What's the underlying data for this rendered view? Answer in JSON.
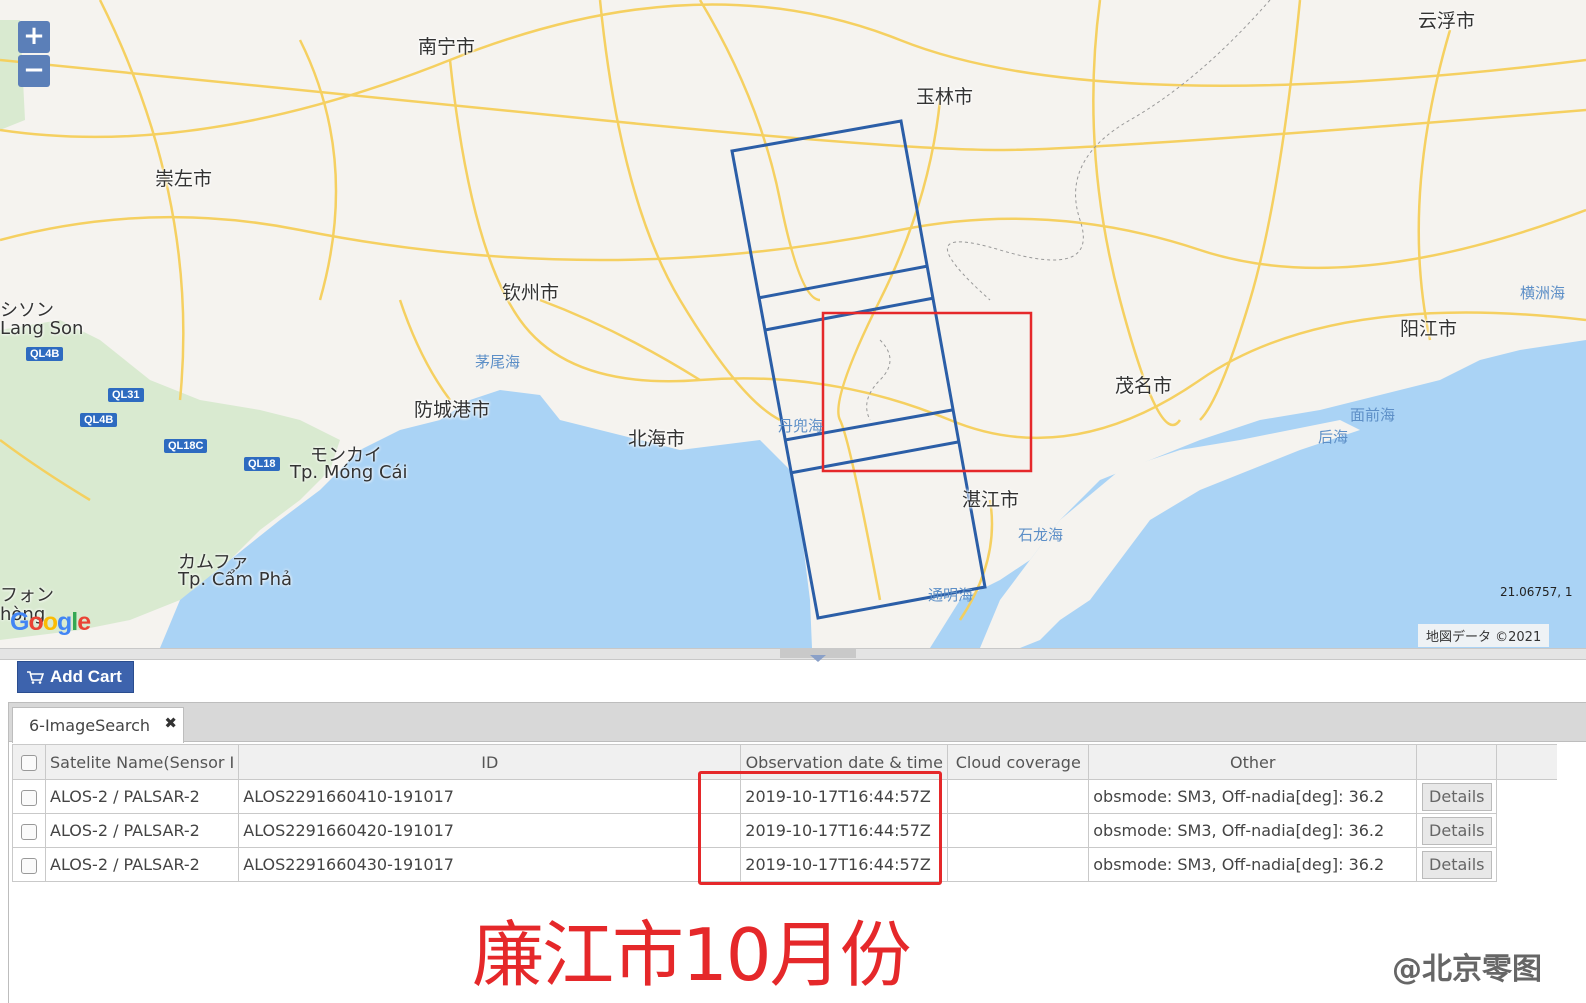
{
  "map": {
    "zoom_in": "+",
    "zoom_out": "−",
    "cities": [
      {
        "name": "南宁市"
      },
      {
        "name": "玉林市"
      },
      {
        "name": "云浮市"
      },
      {
        "name": "崇左市"
      },
      {
        "name": "钦州市"
      },
      {
        "name": "阳江市"
      },
      {
        "name": "茂名市"
      },
      {
        "name": "北海市"
      },
      {
        "name": "湛江市"
      },
      {
        "name": "防城港市"
      }
    ],
    "waters": [
      "茅尾海",
      "丹兜海",
      "石龙海",
      "通明海",
      "面前海",
      "后海",
      "横洲海"
    ],
    "vietnam_labels": [
      "シソン",
      "Lang Son",
      "モンカイ",
      "Tp. Móng Cái",
      "カムファ",
      "Tp. Cẩm Phả",
      "フォン",
      "hòng"
    ],
    "road_shields": [
      "QL4B",
      "QL31",
      "QL4B",
      "QL18C",
      "QL18"
    ],
    "coords": "21.06757, 1",
    "copyright": "地図データ ©2021",
    "colors": {
      "footprint": "#2b5ea7",
      "selection": "#e5282a",
      "sea": "#aad3f5"
    }
  },
  "toolbar": {
    "add_cart": "Add Cart"
  },
  "tab": {
    "label": "6-ImageSearch",
    "close": "✖"
  },
  "table": {
    "columns": [
      "Satelite Name(Sensor I",
      "ID",
      "Observation date & time",
      "Cloud coverage",
      "Other",
      ""
    ],
    "rows": [
      {
        "sat": "ALOS-2 / PALSAR-2",
        "id": "ALOS2291660410-191017",
        "time": "2019-10-17T16:44:57Z",
        "cloud": "",
        "other": "obsmode: SM3, Off-nadia[deg]: 36.2",
        "action": "Details"
      },
      {
        "sat": "ALOS-2 / PALSAR-2",
        "id": "ALOS2291660420-191017",
        "time": "2019-10-17T16:44:57Z",
        "cloud": "",
        "other": "obsmode: SM3, Off-nadia[deg]: 36.2",
        "action": "Details"
      },
      {
        "sat": "ALOS-2 / PALSAR-2",
        "id": "ALOS2291660430-191017",
        "time": "2019-10-17T16:44:57Z",
        "cloud": "",
        "other": "obsmode: SM3, Off-nadia[deg]: 36.2",
        "action": "Details"
      }
    ]
  },
  "annotation": {
    "caption": "廉江市10月份",
    "watermark": "@北京零图"
  }
}
